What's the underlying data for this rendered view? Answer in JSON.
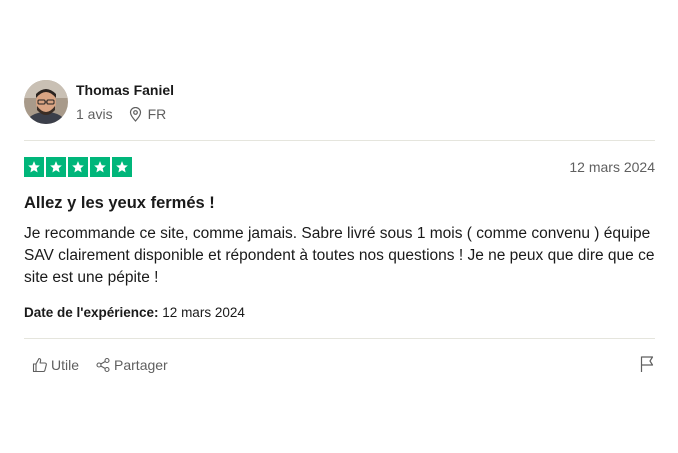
{
  "reviewer": {
    "name": "Thomas Faniel",
    "review_count": "1 avis",
    "country": "FR"
  },
  "review": {
    "rating": 5,
    "max_rating": 5,
    "date": "12 mars 2024",
    "title": "Allez y les yeux fermés !",
    "body": "Je recommande ce site, comme jamais. Sabre livré sous 1 mois ( comme convenu ) équipe SAV clairement disponible et répondent à toutes nos questions ! Je ne peux que dire que ce site est une pépite !",
    "experience_label": "Date de l'expérience:",
    "experience_date": "12 mars 2024"
  },
  "actions": {
    "useful_label": "Utile",
    "share_label": "Partager"
  },
  "colors": {
    "star_green": "#00b67a",
    "muted_text": "#5f5f5f",
    "divider": "#e5e5dd"
  },
  "icons": {
    "location": "map-pin-icon",
    "useful": "thumbs-up-icon",
    "share": "share-icon",
    "report": "flag-icon"
  }
}
